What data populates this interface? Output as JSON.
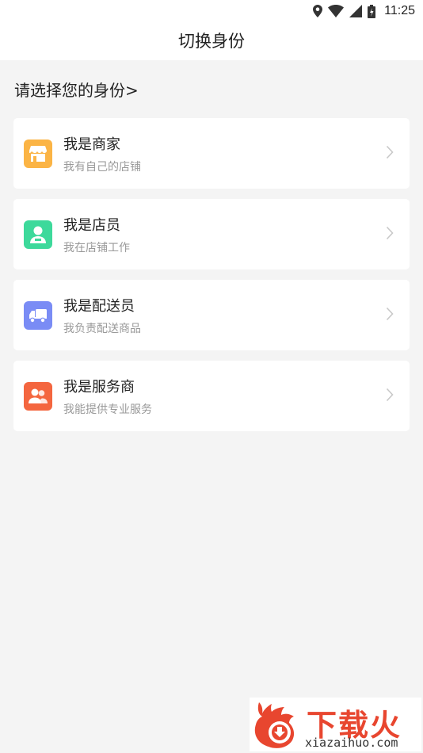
{
  "status_bar": {
    "time": "11:25"
  },
  "header": {
    "title": "切换身份"
  },
  "section_title": "请选择您的身份>",
  "identities": [
    {
      "title": "我是商家",
      "desc": "我有自己的店铺",
      "icon": "store-icon",
      "color": "#fbb445"
    },
    {
      "title": "我是店员",
      "desc": "我在店铺工作",
      "icon": "clerk-icon",
      "color": "#3dd99b"
    },
    {
      "title": "我是配送员",
      "desc": "我负责配送商品",
      "icon": "delivery-truck-icon",
      "color": "#7a8cf5"
    },
    {
      "title": "我是服务商",
      "desc": "我能提供专业服务",
      "icon": "service-provider-icon",
      "color": "#f4663f"
    }
  ],
  "watermark": {
    "name": "下载火",
    "url": "xiazaihuo.com"
  }
}
